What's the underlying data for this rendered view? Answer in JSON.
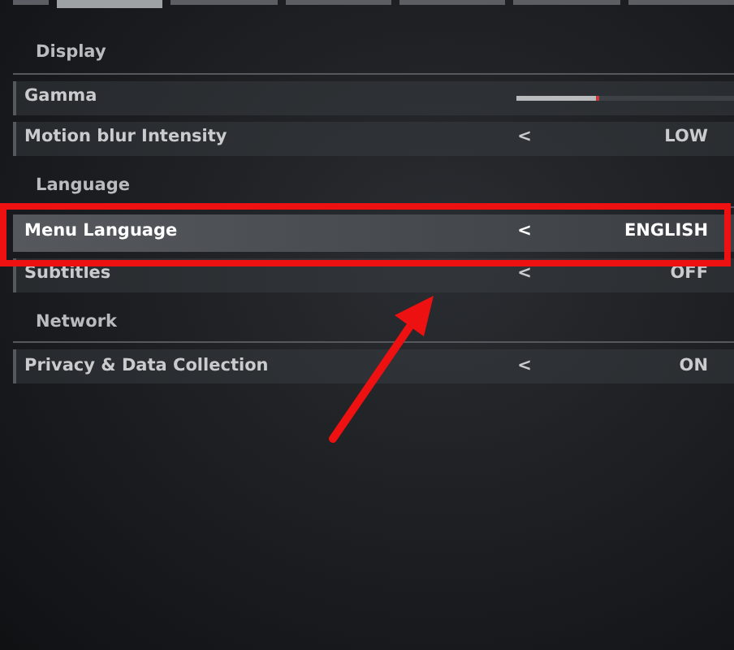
{
  "tabs": [
    {
      "selected": false
    },
    {
      "selected": true
    },
    {
      "selected": false
    },
    {
      "selected": false
    },
    {
      "selected": false
    },
    {
      "selected": false
    },
    {
      "selected": false
    }
  ],
  "sections": [
    {
      "title": "Display",
      "items": [
        {
          "kind": "slider",
          "label": "Gamma",
          "level": 0.38,
          "selected": false,
          "annotated": false
        },
        {
          "kind": "choice",
          "label": "Motion blur Intensity",
          "chevron": "<",
          "value": "LOW",
          "selected": false,
          "annotated": false
        }
      ]
    },
    {
      "title": "Language",
      "items": [
        {
          "kind": "choice",
          "label": "Menu Language",
          "chevron": "<",
          "value": "ENGLISH",
          "selected": true,
          "annotated": true
        },
        {
          "kind": "choice",
          "label": "Subtitles",
          "chevron": "<",
          "value": "OFF",
          "selected": false,
          "annotated": false
        }
      ]
    },
    {
      "title": "Network",
      "items": [
        {
          "kind": "choice",
          "label": "Privacy & Data Collection",
          "chevron": "<",
          "value": "ON",
          "selected": false,
          "annotated": false
        }
      ]
    }
  ]
}
